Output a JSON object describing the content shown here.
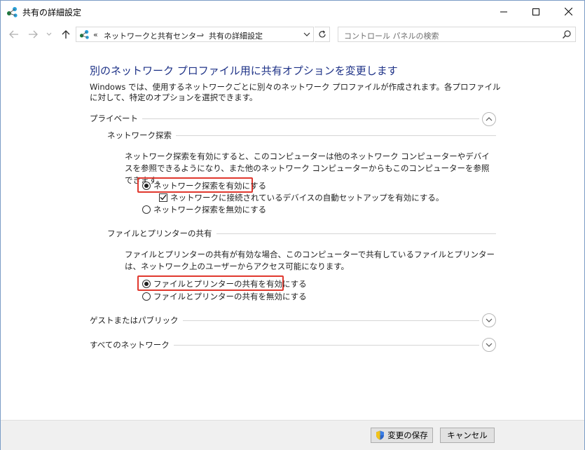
{
  "window": {
    "title": "共有の詳細設定"
  },
  "nav": {
    "breadcrumb": [
      "ネットワークと共有センター",
      "共有の詳細設定"
    ],
    "breadcrumb_prefix": "«",
    "breadcrumb_sep": "›",
    "search_placeholder": "コントロール パネルの検索"
  },
  "content": {
    "heading": "別のネットワーク プロファイル用に共有オプションを変更します",
    "description": "Windows では、使用するネットワークごとに別々のネットワーク プロファイルが作成されます。各プロファイルに対して、特定のオプションを選択できます。",
    "private": {
      "label": "プライベート",
      "network_discovery": {
        "label": "ネットワーク探索",
        "text": "ネットワーク探索を有効にすると、このコンピューターは他のネットワーク コンピューターやデバイスを参照できるようになり、また他のネットワーク コンピューターからもこのコンピューターを参照できます。",
        "opt_on": "ネットワーク探索を有効にする",
        "opt_auto": "ネットワークに接続されているデバイスの自動セットアップを有効にする。",
        "opt_off": "ネットワーク探索を無効にする",
        "selected": "on",
        "auto_checked": true
      },
      "file_sharing": {
        "label": "ファイルとプリンターの共有",
        "text": "ファイルとプリンターの共有が有効な場合、このコンピューターで共有しているファイルとプリンターは、ネットワーク上のユーザーからアクセス可能になります。",
        "opt_on": "ファイルとプリンターの共有を有効にする",
        "opt_off": "ファイルとプリンターの共有を無効にする",
        "selected": "on"
      }
    },
    "guest_public": {
      "label": "ゲストまたはパブリック"
    },
    "all_networks": {
      "label": "すべてのネットワーク"
    }
  },
  "footer": {
    "save_label": "変更の保存",
    "cancel_label": "キャンセル"
  },
  "colors": {
    "heading": "#1e3287",
    "highlight": "#e0382e",
    "footer_bg": "#f0f0f0"
  }
}
